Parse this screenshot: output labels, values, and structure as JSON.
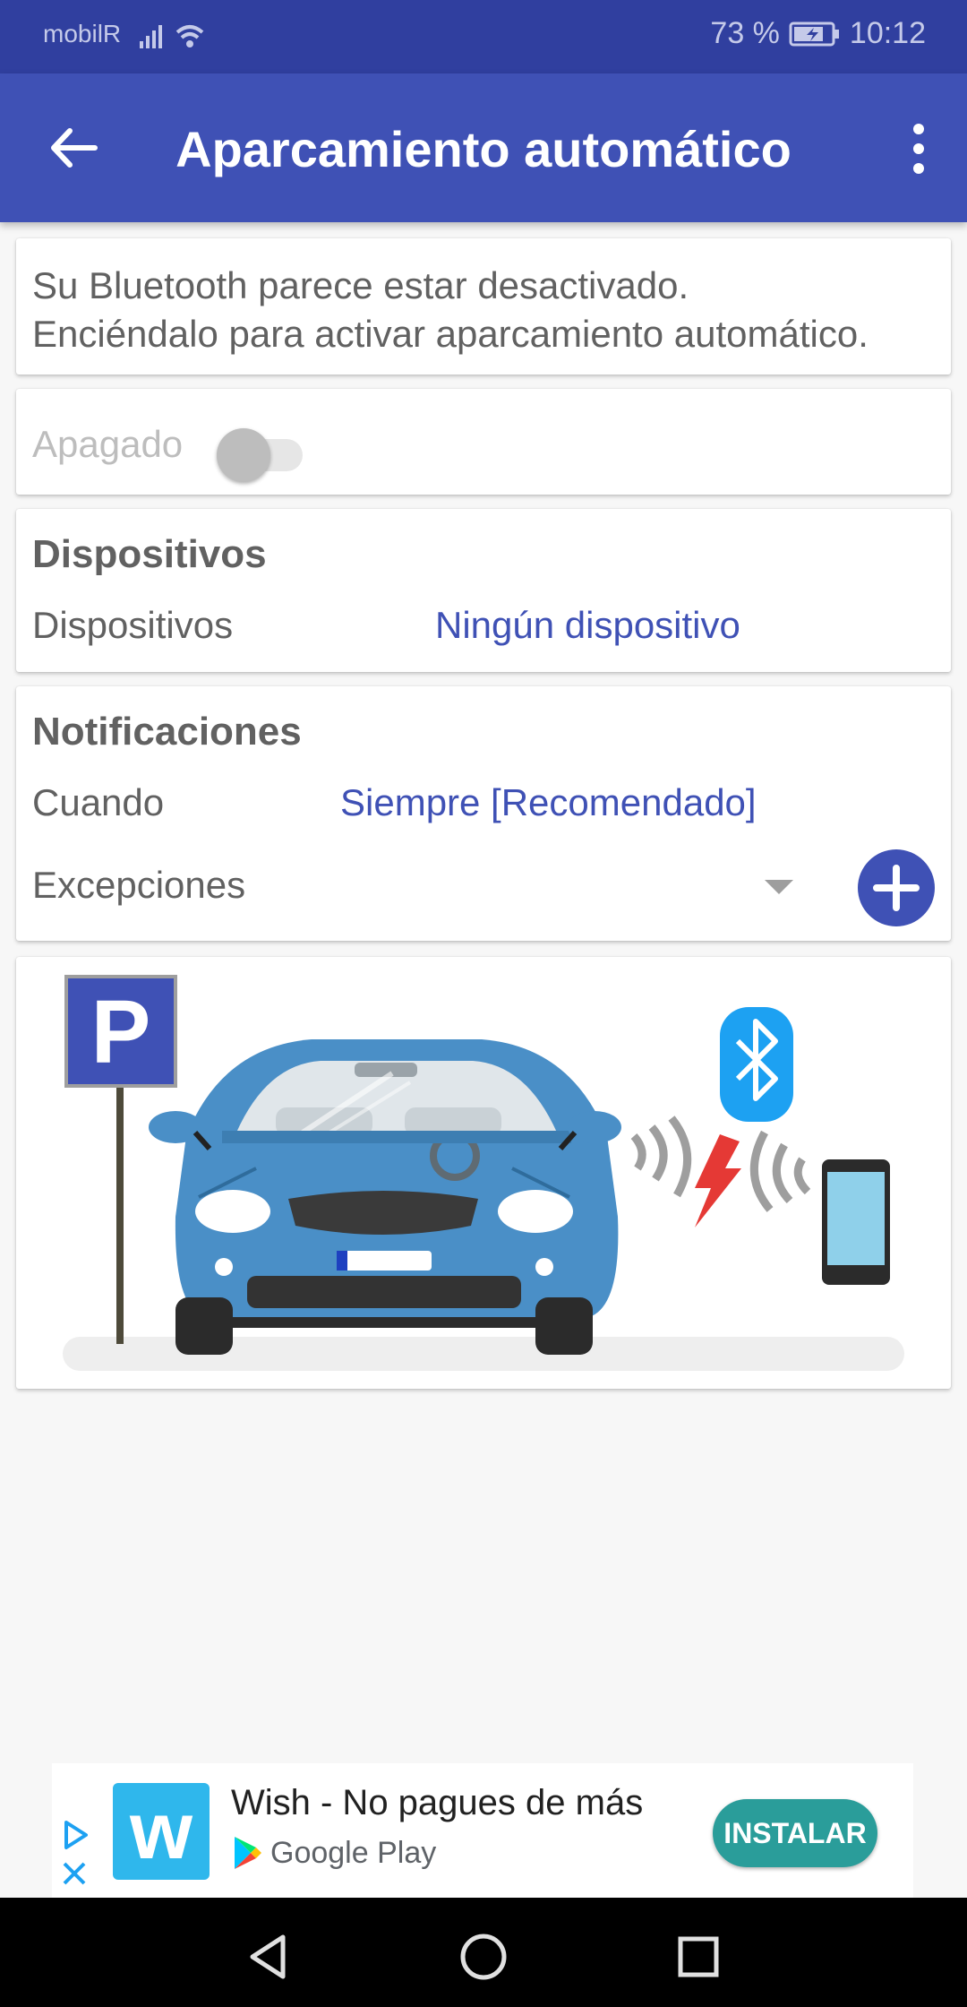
{
  "status_bar": {
    "carrier": "mobilR",
    "battery": "73 %",
    "time": "10:12"
  },
  "app_bar": {
    "title": "Aparcamiento automático",
    "back_icon": "arrow-back-icon",
    "menu_icon": "more-vert-icon"
  },
  "bluetooth_warning": {
    "line1": "Su Bluetooth parece estar desactivado.",
    "line2": "Enciéndalo para activar aparcamiento automático."
  },
  "auto_park_toggle": {
    "label": "Apagado",
    "state": "off"
  },
  "devices": {
    "heading": "Dispositivos",
    "label": "Dispositivos",
    "value": "Ningún dispositivo"
  },
  "notifications": {
    "heading": "Notificaciones",
    "when_label": "Cuando",
    "when_value": "Siempre [Recomendado]",
    "exceptions_label": "Excepciones"
  },
  "illustration": {
    "parking_sign": "P"
  },
  "ad": {
    "title": "Wish - No pagues de más",
    "store": "Google Play",
    "install": "INSTALAR",
    "logo_letter": "w"
  },
  "colors": {
    "primary": "#3f51b5",
    "primary_dark": "#303f9f",
    "accent_blue": "#3f51b5"
  }
}
